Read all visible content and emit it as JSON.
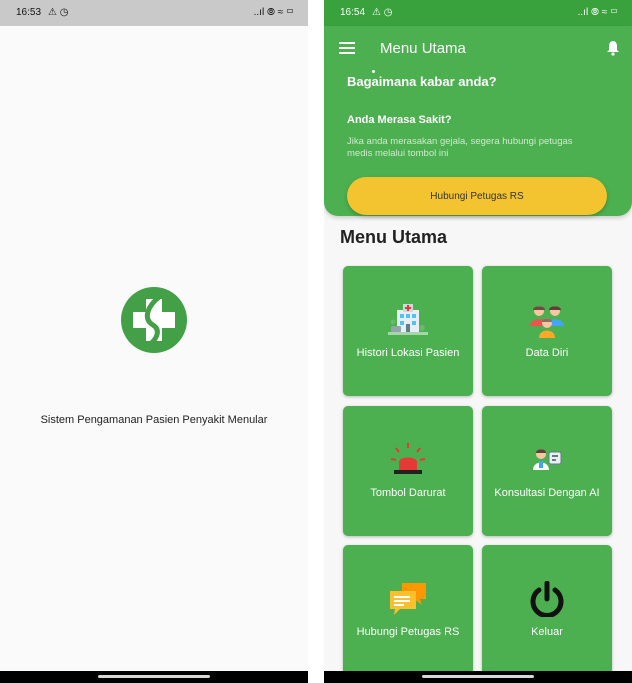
{
  "left": {
    "status_time": "16:53",
    "status_left_icons": "⚠ ◷",
    "status_right_icons": "..ıl ⦾ ≈ ▭",
    "tagline": "Sistem Pengamanan Pasien Penyakit Menular"
  },
  "right": {
    "status_time": "16:54",
    "status_left_icons": "⚠ ◷",
    "status_right_icons": "..ıl ⦾ ≈ ▭",
    "app_title": "Menu Utama",
    "greeting": "Bagaimana kabar anda?",
    "sick_question": "Anda Merasa Sakit?",
    "sick_description": "Jika anda merasakan gejala, segera hubungi petugas medis melalui tombol ini",
    "call_button": "Hubungi Petugas RS",
    "section_title": "Menu Utama",
    "menu": [
      {
        "label": "Histori Lokasi Pasien",
        "icon": "hospital-building-icon"
      },
      {
        "label": "Data Diri",
        "icon": "family-people-icon"
      },
      {
        "label": "Tombol Darurat",
        "icon": "siren-alarm-icon"
      },
      {
        "label": "Konsultasi Dengan AI",
        "icon": "doctor-chat-icon"
      },
      {
        "label": "Hubungi Petugas RS",
        "icon": "chat-bubbles-icon"
      },
      {
        "label": "Keluar",
        "icon": "power-icon"
      }
    ]
  },
  "colors": {
    "primary_green": "#4caf50",
    "status_green": "#39a23d",
    "accent_yellow": "#f4c430",
    "siren_red": "#e53935"
  }
}
